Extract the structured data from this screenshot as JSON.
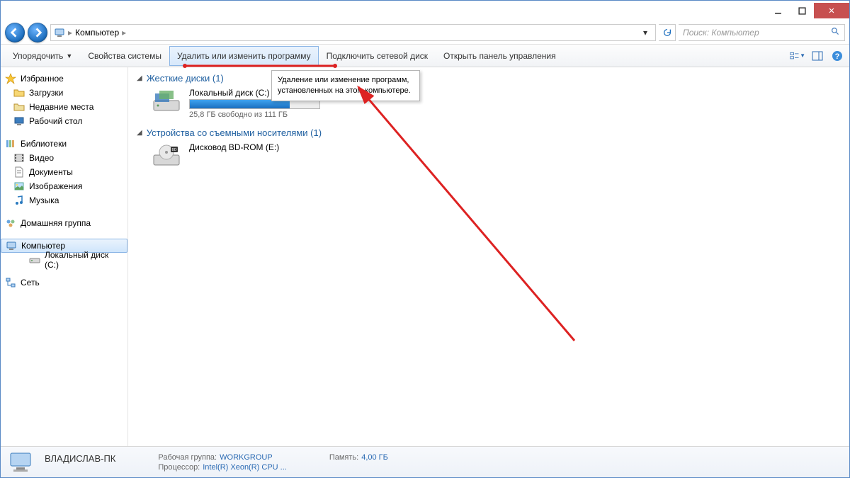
{
  "colors": {
    "accent": "#1e6fbf",
    "link": "#1e5fa0",
    "close": "#c75050"
  },
  "breadcrumb": {
    "root": "Компьютер"
  },
  "search": {
    "placeholder": "Поиск: Компьютер"
  },
  "toolbar": {
    "organize": "Упорядочить",
    "system_props": "Свойства системы",
    "uninstall": "Удалить или изменить программу",
    "map_drive": "Подключить сетевой диск",
    "control_panel": "Открыть панель управления"
  },
  "tooltip": {
    "text": "Удаление или изменение программ, установленных на этом компьютере."
  },
  "sidebar": {
    "favorites": {
      "label": "Избранное",
      "items": [
        "Загрузки",
        "Недавние места",
        "Рабочий стол"
      ]
    },
    "libraries": {
      "label": "Библиотеки",
      "items": [
        "Видео",
        "Документы",
        "Изображения",
        "Музыка"
      ]
    },
    "homegroup": {
      "label": "Домашняя группа"
    },
    "computer": {
      "label": "Компьютер",
      "items": [
        "Локальный диск (C:)"
      ]
    },
    "network": {
      "label": "Сеть"
    }
  },
  "main": {
    "hdd_header": "Жесткие диски (1)",
    "drive_c": {
      "name": "Локальный диск (C:)",
      "free_text": "25,8 ГБ свободно из 111 ГБ",
      "fill_percent": 77
    },
    "removable_header": "Устройства со съемными носителями (1)",
    "bd": {
      "name": "Дисковод BD-ROM (E:)"
    }
  },
  "status": {
    "hostname": "ВЛАДИСЛАВ-ПК",
    "workgroup_label": "Рабочая группа:",
    "workgroup": "WORKGROUP",
    "cpu_label": "Процессор:",
    "cpu": "Intel(R) Xeon(R) CPU    ...",
    "mem_label": "Память:",
    "mem": "4,00 ГБ"
  }
}
